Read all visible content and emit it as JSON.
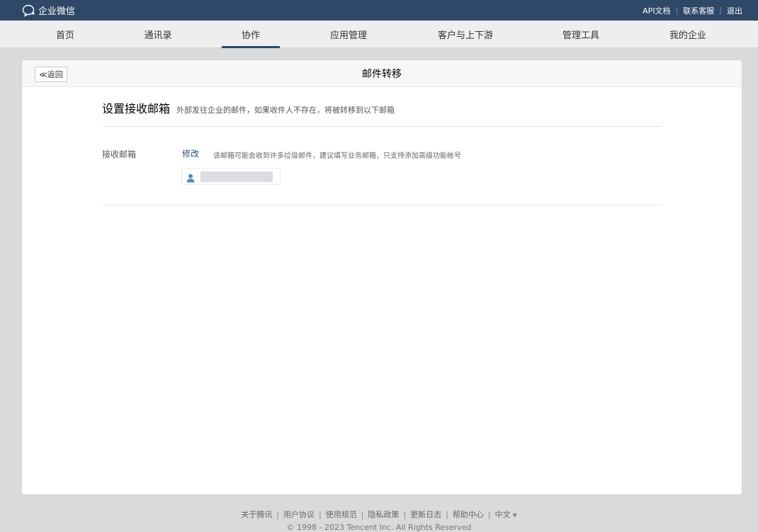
{
  "brand": {
    "name": "企业微信"
  },
  "top_links": [
    "API文档",
    "联系客服",
    "退出"
  ],
  "nav": {
    "items": [
      "首页",
      "通讯录",
      "协作",
      "应用管理",
      "客户与上下游",
      "管理工具",
      "我的企业"
    ],
    "active": "协作"
  },
  "panel": {
    "back_label": "≪返回",
    "title": "邮件转移",
    "section_title": "设置接收邮箱",
    "section_desc": "外部发往企业的邮件，如果收件人不存在，将被转移到以下邮箱",
    "field_label": "接收邮箱",
    "modify_label": "修改",
    "field_hint": "该邮箱可能会收到许多垃圾邮件，建议填写业务邮箱，只支持添加高级功能帐号"
  },
  "footer": {
    "links": [
      "关于腾讯",
      "用户协议",
      "使用规范",
      "隐私政策",
      "更新日志",
      "帮助中心",
      "中文"
    ],
    "copyright": "© 1998 - 2023 Tencent Inc. All Rights Reserved"
  },
  "colors": {
    "topbar": "#2f4868",
    "link": "#2a4f80",
    "background": "#d9dadb"
  }
}
